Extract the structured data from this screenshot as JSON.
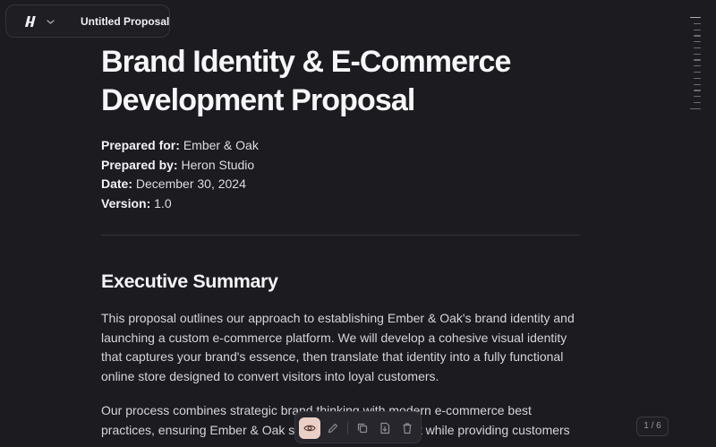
{
  "app": {
    "document_name": "Untitled Proposal",
    "logo_icon": "brand-logo-icon",
    "menu_icon": "chevron-down-icon"
  },
  "document": {
    "title_line1": "Brand Identity & E-Commerce",
    "title_line2": "Development Proposal",
    "meta": [
      {
        "label": "Prepared for:",
        "value": "Ember & Oak"
      },
      {
        "label": "Prepared by:",
        "value": "Heron Studio"
      },
      {
        "label": "Date:",
        "value": "December 30, 2024"
      },
      {
        "label": "Version:",
        "value": "1.0"
      }
    ],
    "section_heading": "Executive Summary",
    "paragraph1": "This proposal outlines our approach to establishing Ember & Oak's brand identity and launching a custom e-commerce platform. We will develop a cohesive visual identity that captures your brand's essence, then translate that identity into a fully functional online store designed to convert visitors into loyal customers.",
    "paragraph2": "Our process combines strategic brand thinking with modern e-commerce best practices, ensuring Ember & Oak stands out in the market while providing customers"
  },
  "toolbar": {
    "tools": [
      {
        "icon": "eye-icon",
        "active": true
      },
      {
        "icon": "pencil-icon",
        "active": false
      },
      {
        "icon": "copy-icon",
        "active": false
      },
      {
        "icon": "download-icon",
        "active": false
      },
      {
        "icon": "trash-icon",
        "active": false
      }
    ],
    "accent_color": "#e9cfc6"
  },
  "pager": {
    "text": "1 / 6"
  }
}
